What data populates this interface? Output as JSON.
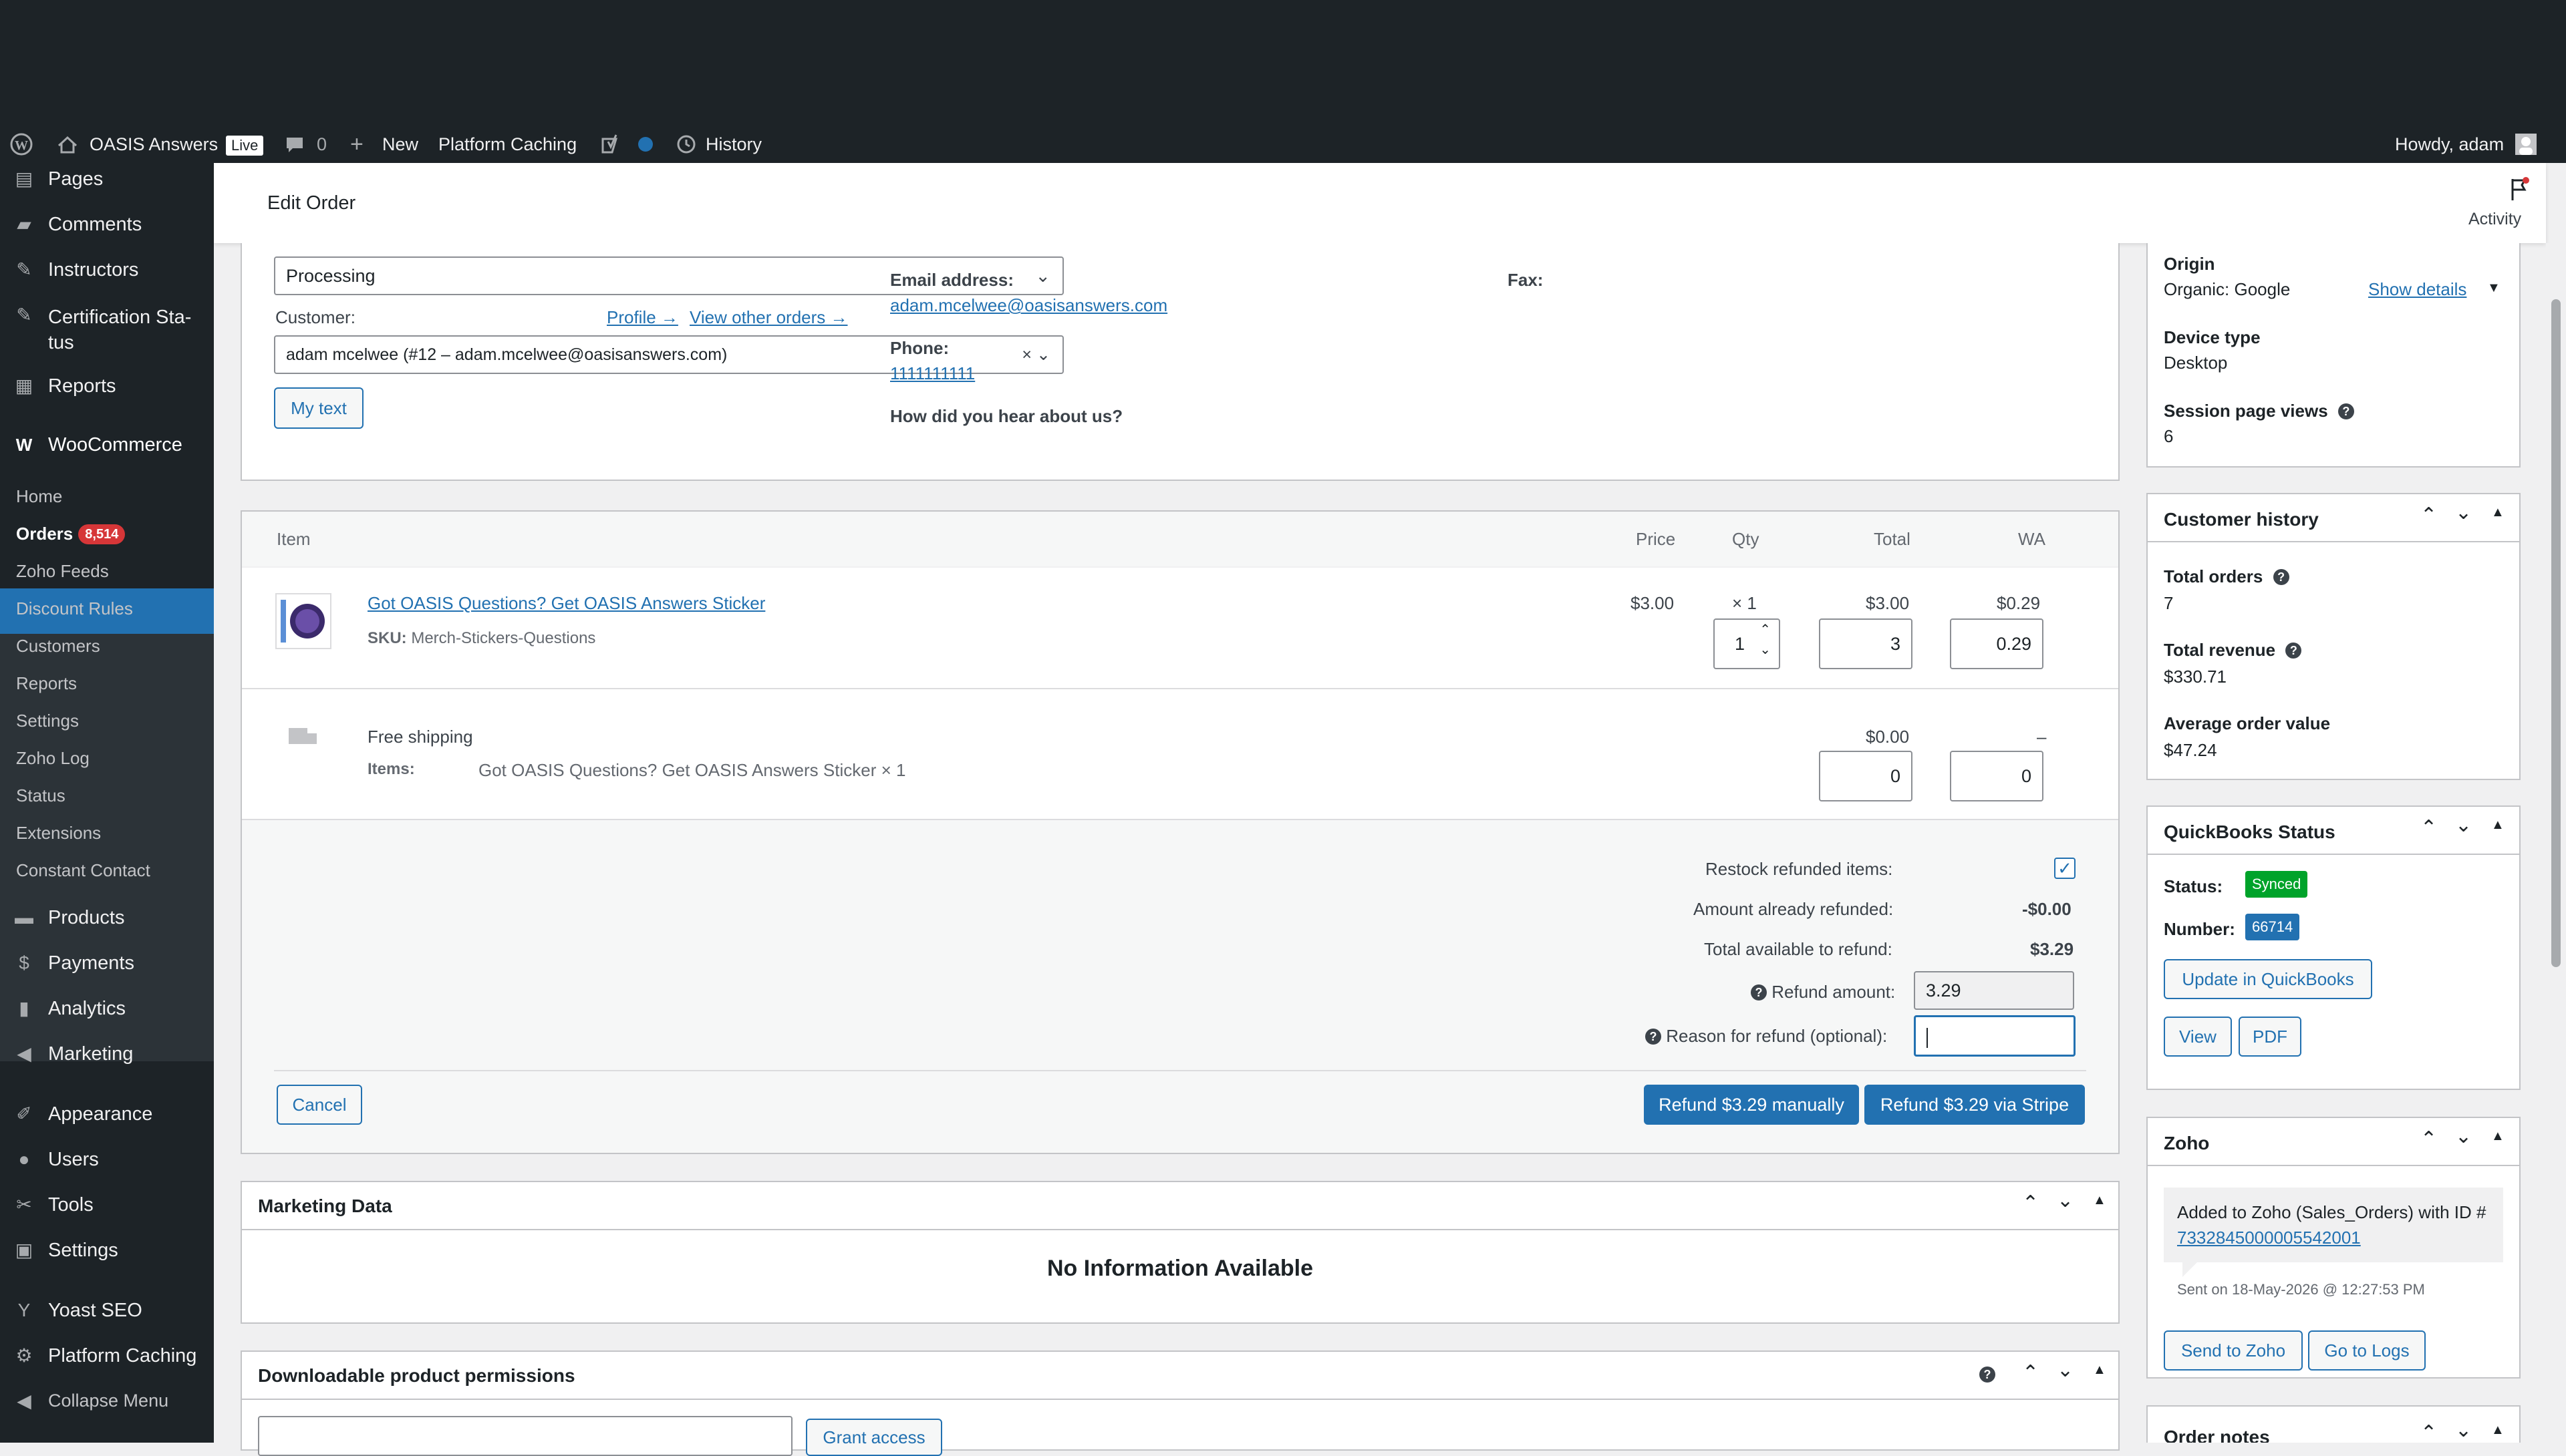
{
  "adminbar": {
    "site_name": "OASIS Answers",
    "live_badge": "Live",
    "comments_count": "0",
    "new_label": "New",
    "platform_caching": "Platform Caching",
    "history": "History",
    "howdy": "Howdy, adam"
  },
  "sidebar": {
    "top_items": [
      {
        "label": "Pages"
      },
      {
        "label": "Comments"
      },
      {
        "label": "Instructors"
      },
      {
        "label": "Certification Sta-\ntus"
      },
      {
        "label": "Reports"
      }
    ],
    "woocommerce": "WooCommerce",
    "sub_items": [
      "Home",
      "Orders",
      "Zoho Feeds",
      "Discount Rules",
      "Customers",
      "Reports",
      "Settings",
      "Zoho Log",
      "Status",
      "Extensions",
      "Constant Contact"
    ],
    "orders_count": "8,514",
    "bottom_items": [
      "Products",
      "Payments",
      "Analytics",
      "Marketing",
      "Appearance",
      "Users",
      "Tools",
      "Settings",
      "Yoast SEO",
      "Platform Caching",
      "Collapse Menu"
    ]
  },
  "header": {
    "title": "Edit Order",
    "activity": "Activity"
  },
  "order": {
    "status_value": "Processing",
    "customer_label": "Customer:",
    "profile_link": "Profile →",
    "other_orders_link": "View other orders →",
    "customer_value": "adam mcelwee (#12 – adam.mcelwee@oasisanswers.com)",
    "my_text_button": "My text",
    "email_label": "Email address:",
    "email_value": "adam.mcelwee@oasisanswers.com",
    "phone_label": "Phone:",
    "phone_value": "1111111111",
    "hear_label": "How did you hear about us?",
    "fax_label": "Fax:"
  },
  "items": {
    "headers": {
      "item": "Item",
      "price": "Price",
      "qty": "Qty",
      "total": "Total",
      "wa": "WA"
    },
    "product_name": "Got OASIS Questions? Get OASIS Answers Sticker",
    "sku_label": "SKU:",
    "sku_value": "Merch-Stickers-Questions",
    "price": "$3.00",
    "qty_text": "× 1",
    "total": "$3.00",
    "wa": "$0.29",
    "qty_input": "1",
    "total_input": "3",
    "wa_input": "0.29",
    "shipping_name": "Free shipping",
    "shipping_items_label": "Items:",
    "shipping_items_value": "Got OASIS Questions? Get OASIS Answers Sticker × 1",
    "shipping_total": "$0.00",
    "shipping_wa": "–",
    "shipping_total_input": "0",
    "shipping_wa_input": "0"
  },
  "refund": {
    "restock_label": "Restock refunded items:",
    "already_label": "Amount already refunded:",
    "already_value": "-$0.00",
    "available_label": "Total available to refund:",
    "available_value": "$3.29",
    "amount_label": "Refund amount:",
    "amount_value": "3.29",
    "reason_label": "Reason for refund (optional):",
    "cancel": "Cancel",
    "manual": "Refund $3.29 manually",
    "stripe": "Refund $3.29 via Stripe"
  },
  "marketing": {
    "title": "Marketing Data",
    "empty": "No Information Available"
  },
  "downloads": {
    "title": "Downloadable product permissions",
    "grant": "Grant access"
  },
  "attribution": {
    "origin_label": "Origin",
    "origin_value": "Organic: Google",
    "show_details": "Show details",
    "device_label": "Device type",
    "device_value": "Desktop",
    "views_label": "Session page views",
    "views_value": "6"
  },
  "customer_history": {
    "title": "Customer history",
    "total_orders_label": "Total orders",
    "total_orders": "7",
    "revenue_label": "Total revenue",
    "revenue": "$330.71",
    "aov_label": "Average order value",
    "aov": "$47.24"
  },
  "quickbooks": {
    "title": "QuickBooks Status",
    "status_label": "Status:",
    "status_value": "Synced",
    "number_label": "Number:",
    "number_value": "66714",
    "update": "Update in QuickBooks",
    "view": "View",
    "pdf": "PDF"
  },
  "zoho": {
    "title": "Zoho",
    "note_text": "Added to Zoho (Sales_Orders) with ID #",
    "note_id": "7332845000005542001",
    "sent": "Sent on 18-May-2026 @ 12:27:53 PM",
    "send": "Send to Zoho",
    "logs": "Go to Logs"
  },
  "order_notes": {
    "title": "Order notes"
  },
  "colors": {
    "accent": "#2271b1",
    "admin_dark": "#1d2327",
    "synced_green": "#00a32a",
    "badge_blue": "#2271b1",
    "count_red": "#d63638"
  }
}
